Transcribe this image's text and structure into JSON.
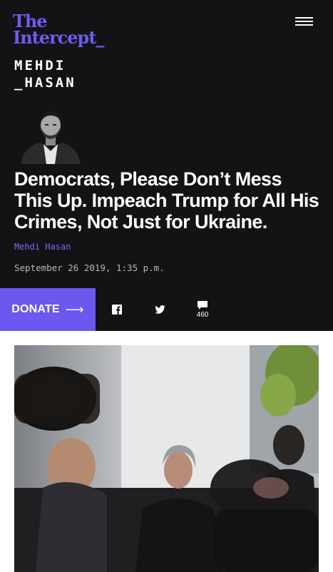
{
  "brand": {
    "logo_line1": "The",
    "logo_line2": "Intercept_"
  },
  "header": {
    "menu_icon": "hamburger-menu-icon"
  },
  "column": {
    "line1": "MEHDI",
    "line2": "_HASAN"
  },
  "article": {
    "headline": "Democrats, Please Don’t Mess This Up. Impeach Trump for All His Crimes, Not Just for Ukraine.",
    "author": "Mehdi Hasan",
    "date": "September 26 2019, 1:35 p.m."
  },
  "actions": {
    "donate_label": "DONATE",
    "donate_arrow": "⟶",
    "facebook_icon": "facebook-icon",
    "twitter_icon": "twitter-icon",
    "comments_icon": "comment-icon",
    "comment_count": "460"
  },
  "colors": {
    "background": "#141214",
    "brand_purple": "#6b5cf0",
    "donate_bg": "#6a58ef",
    "author_link": "#7b6cf6"
  }
}
